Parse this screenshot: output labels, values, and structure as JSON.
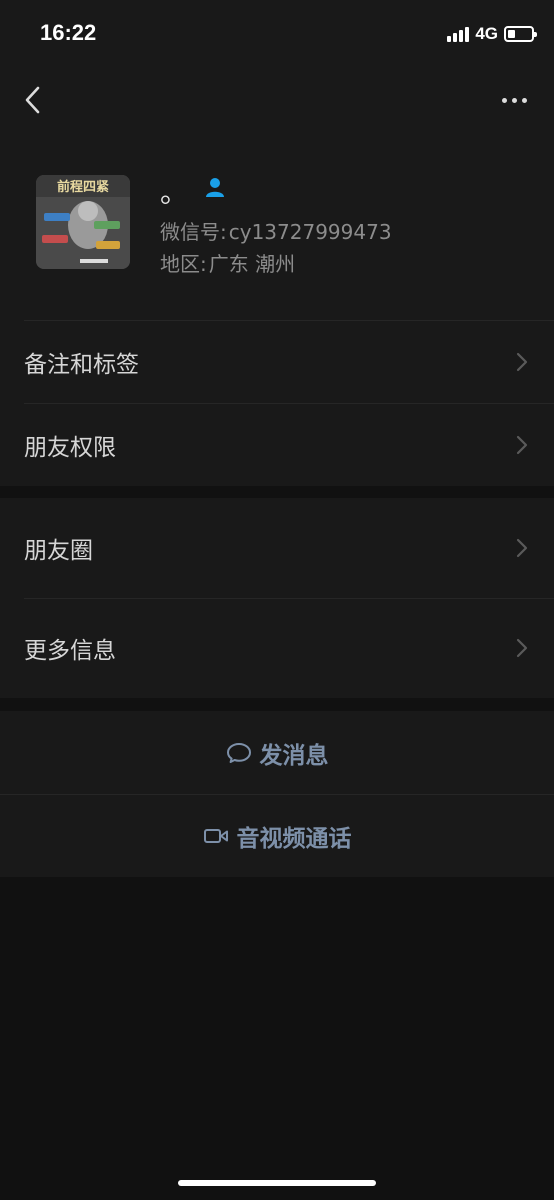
{
  "status_bar": {
    "time": "16:22",
    "network": "4G",
    "battery_level": 0.3,
    "signal_bars": 4
  },
  "nav": {
    "back_icon": "chevron-left-icon",
    "more_icon": "more-dots-icon"
  },
  "profile": {
    "nickname": "。",
    "badge_icon": "person-icon",
    "wechat_id_label": "微信号:",
    "wechat_id": "cy13727999473",
    "region_label": "地区:",
    "region": "广东 潮州",
    "avatar_text": "前程四紧"
  },
  "menu_group_1": [
    {
      "label": "备注和标签"
    },
    {
      "label": "朋友权限"
    }
  ],
  "menu_group_2": [
    {
      "label": "朋友圈"
    },
    {
      "label": "更多信息"
    }
  ],
  "actions": {
    "message": {
      "label": "发消息",
      "icon": "chat-bubble-icon"
    },
    "call": {
      "label": "音视频通话",
      "icon": "video-camera-icon"
    }
  },
  "colors": {
    "background": "#111111",
    "surface": "#191919",
    "accent_link": "#7d90a9",
    "badge_blue": "#1aa0e8"
  }
}
